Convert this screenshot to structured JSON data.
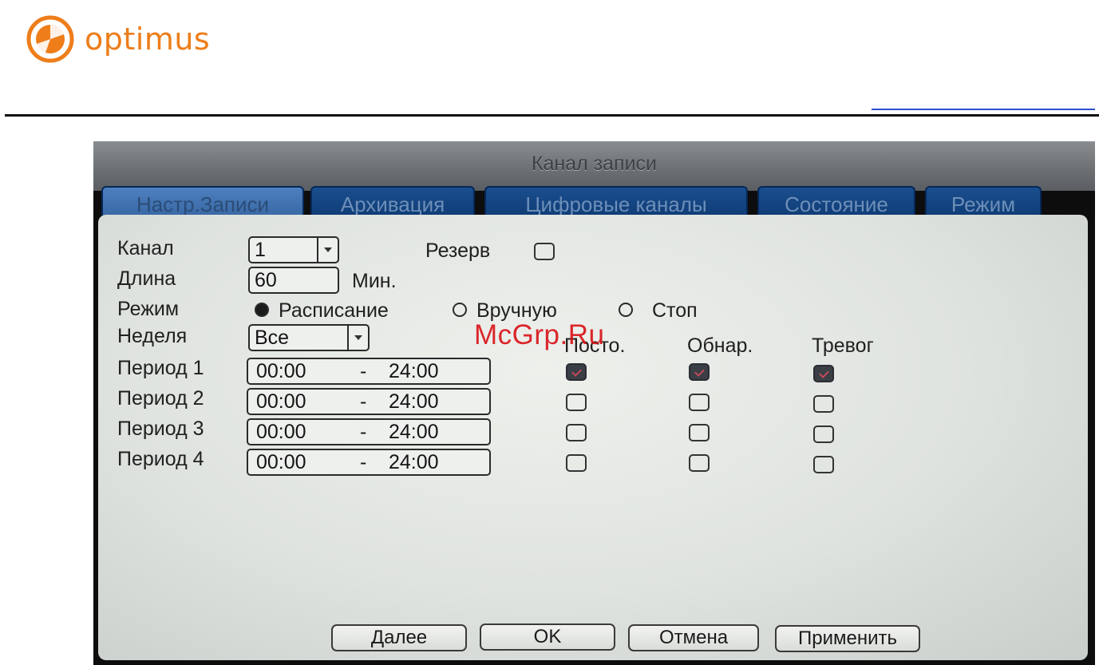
{
  "header": {
    "logo_text": "optimus",
    "brand_color": "#ee7d1a"
  },
  "dialog": {
    "title": "Канал записи",
    "tabs": [
      {
        "label": "Настр.Записи",
        "active": true
      },
      {
        "label": "Архивация",
        "active": false
      },
      {
        "label": "Цифровые каналы",
        "active": false
      },
      {
        "label": "Состояние",
        "active": false
      },
      {
        "label": "Режим",
        "active": false
      }
    ],
    "channel": {
      "label": "Канал",
      "value": "1"
    },
    "backup": {
      "label": "Резерв",
      "checked": false
    },
    "length": {
      "label": "Длина",
      "value": "60",
      "unit": "Мин."
    },
    "mode": {
      "label": "Режим",
      "options": [
        "Расписание",
        "Вручную",
        "Стоп"
      ],
      "selected": "Расписание"
    },
    "week": {
      "label": "Неделя",
      "value": "Все"
    },
    "columns": [
      "Посто.",
      "Обнар.",
      "Тревог"
    ],
    "periods": [
      {
        "label": "Период 1",
        "start": "00:00",
        "separator": "-",
        "end": "24:00",
        "checks": [
          true,
          true,
          true
        ]
      },
      {
        "label": "Период 2",
        "start": "00:00",
        "separator": "-",
        "end": "24:00",
        "checks": [
          false,
          false,
          false
        ]
      },
      {
        "label": "Период 3",
        "start": "00:00",
        "separator": "-",
        "end": "24:00",
        "checks": [
          false,
          false,
          false
        ]
      },
      {
        "label": "Период 4",
        "start": "00:00",
        "separator": "-",
        "end": "24:00",
        "checks": [
          false,
          false,
          false
        ]
      }
    ],
    "buttons": {
      "next": "Далее",
      "ok": "OK",
      "cancel": "Отмена",
      "apply": "Применить"
    }
  },
  "watermark": "McGrp.Ru"
}
